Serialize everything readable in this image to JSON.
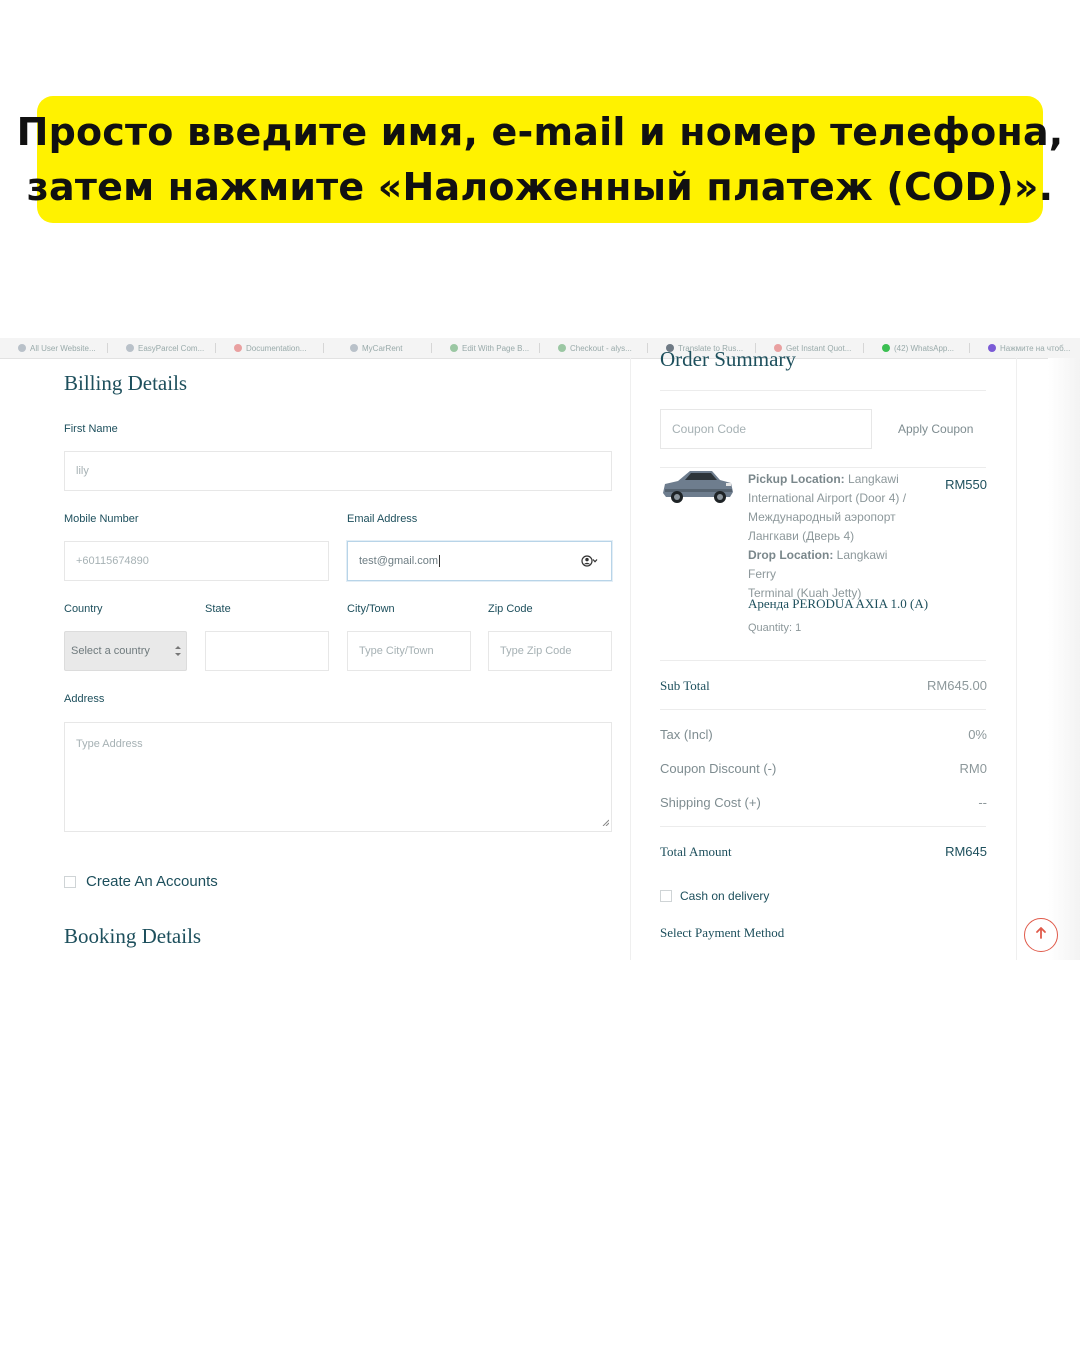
{
  "banner": {
    "line1": "Просто введите имя, e-mail и номер телефона,",
    "line2": "затем нажмите «Наложенный платеж (COD)»."
  },
  "browser_tabs": [
    "All User Website...",
    "EasyParcel Com...",
    "Documentation...",
    "MyCarRent",
    "Edit With Page B...",
    "Checkout - alys...",
    "Translate to Rus...",
    "Get Instant Quot...",
    "(42) WhatsApp...",
    "Нажмите на чтоб..."
  ],
  "billing": {
    "title": "Billing Details",
    "first_name_label": "First Name",
    "first_name_value": "lily",
    "mobile_label": "Mobile Number",
    "mobile_value": "+60115674890",
    "email_label": "Email Address",
    "email_value": "test@gmail.com",
    "country_label": "Country",
    "country_value": "Select a country",
    "state_label": "State",
    "city_label": "City/Town",
    "city_placeholder": "Type City/Town",
    "zip_label": "Zip Code",
    "zip_placeholder": "Type Zip Code",
    "address_label": "Address",
    "address_placeholder": "Type Address",
    "create_account_label": "Create An Accounts"
  },
  "booking": {
    "title": "Booking Details"
  },
  "summary": {
    "title": "Order Summary",
    "coupon_placeholder": "Coupon Code",
    "apply_coupon_label": "Apply Coupon",
    "item": {
      "pickup_label": "Pickup Location:",
      "pickup_line1": "Langkawi",
      "pickup_line2": "International Airport (Door 4) /",
      "pickup_line3": "Международный аэропорт",
      "pickup_line4": "Лангкави (Дверь 4)",
      "drop_label": "Drop Location:",
      "drop_line1": "Langkawi Ferry",
      "drop_line2": "Terminal (Kuah Jetty)",
      "price": "RM550",
      "name": "Аренда PERODUA AXIA 1.0 (A)",
      "quantity": "Quantity: 1"
    },
    "subtotal_label": "Sub Total",
    "subtotal_value": "RM645.00",
    "tax_label": "Tax (Incl)",
    "tax_value": "0%",
    "coupon_discount_label": "Coupon Discount (-)",
    "coupon_discount_value": "RM0",
    "shipping_label": "Shipping Cost (+)",
    "shipping_value": "--",
    "total_label": "Total Amount",
    "total_value": "RM645",
    "cod_label": "Cash on delivery",
    "payment_method_label": "Select Payment Method"
  },
  "colors": {
    "banner_bg": "#fff200",
    "heading": "#1d4f5c",
    "scroll_top_accent": "#e05a4a"
  },
  "icons": {
    "autofill": "user-circle-icon",
    "scroll_top": "arrow-up-icon"
  }
}
